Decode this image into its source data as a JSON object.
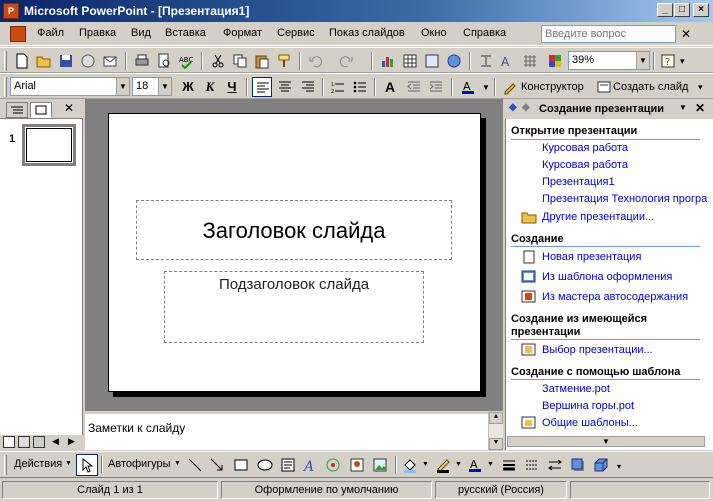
{
  "window": {
    "title": "Microsoft PowerPoint - [Презентация1]",
    "app_icon_label": "P"
  },
  "menu": {
    "items": [
      "Файл",
      "Правка",
      "Вид",
      "Вставка",
      "Формат",
      "Сервис",
      "Показ слайдов",
      "Окно",
      "Справка"
    ],
    "ask_placeholder": "Введите вопрос"
  },
  "standard_toolbar": {
    "zoom": "39%"
  },
  "formatting_toolbar": {
    "font": "Arial",
    "size": "18",
    "designer_label": "Конструктор",
    "new_slide_label": "Создать слайд"
  },
  "slide_panel": {
    "slide_number": "1"
  },
  "slide": {
    "title_placeholder": "Заголовок слайда",
    "subtitle_placeholder": "Подзаголовок слайда"
  },
  "notes": {
    "placeholder": "Заметки к слайду"
  },
  "task_pane": {
    "title": "Создание презентации",
    "open_section": "Открытие презентации",
    "recent_files": [
      "Курсовая работа",
      "Курсовая работа",
      "Презентация1",
      "Презентация Технология програ"
    ],
    "more_presentations": "Другие презентации...",
    "new_section": "Создание",
    "new_links": [
      "Новая презентация",
      "Из шаблона оформления",
      "Из мастера автосодержания"
    ],
    "existing_section": [
      "Создание из имеющейся",
      "презентации"
    ],
    "existing_link": "Выбор презентации...",
    "template_section": "Создание с помощью шаблона",
    "template_links": [
      "Затмение.pot",
      "Вершина горы.pot",
      "Общие шаблоны..."
    ]
  },
  "drawing_toolbar": {
    "actions_label": "Действия",
    "autoshapes_label": "Автофигуры"
  },
  "status_bar": {
    "slide_info": "Слайд 1 из 1",
    "design": "Оформление по умолчанию",
    "language": "русский (Россия)"
  },
  "colors": {
    "titlebar_start": "#0a246a",
    "link": "#0000cc",
    "section_rule": "#7a96df",
    "chrome": "#d4d0c8"
  }
}
